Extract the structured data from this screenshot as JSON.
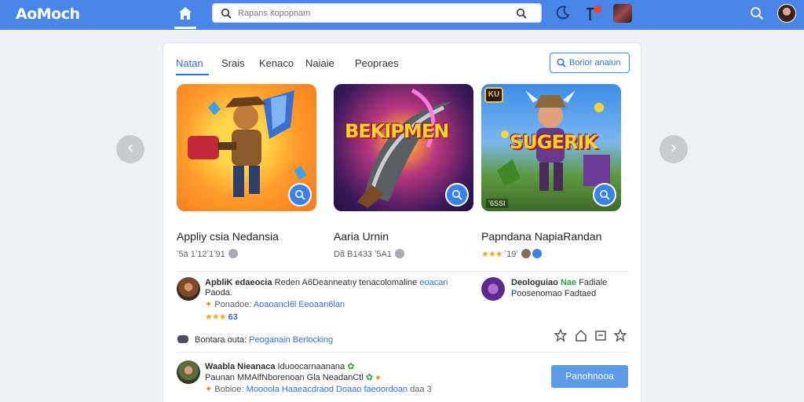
{
  "app": {
    "logo": "AoMoch"
  },
  "search": {
    "placeholder": "Rapans itopopnam",
    "value": ""
  },
  "tabs": [
    {
      "label": "Natan",
      "active": true
    },
    {
      "label": "Srais"
    },
    {
      "label": "Kenaco"
    },
    {
      "label": "Naiaie"
    },
    {
      "label": "Peopraes"
    }
  ],
  "card_action": {
    "label": "Borior anaiun"
  },
  "games": [
    {
      "title": "Appliy csia Nedansia",
      "meta": "ʼ5ä 1ʼ12ʼ1ʼ91"
    },
    {
      "art_text": "BEKIPMEN",
      "title": "Aaria Urnin",
      "meta": "Dã B1433 ʼ5A1"
    },
    {
      "art_text": "SUGERIK",
      "corner_badge": "KU",
      "bottom_tag": "ʼ6SSI",
      "title": "Papndana NapiaRandan",
      "stars": "★★★",
      "meta": "ʼ19ʼ"
    }
  ],
  "review1": {
    "name": "ApbliK edaeocia",
    "text": "Reden A6Deanneatıy tenacolomaline",
    "link": "eoacan",
    "line2": "Paoda.",
    "line3_prefix": "Ponadoe:",
    "line3_link": "Aoaoancl6l Eeoaan6lan",
    "stars": "★★★",
    "count": "63"
  },
  "review2": {
    "name": "Deologuiao",
    "name_tag": "Nae",
    "tag": "Fadiale",
    "line2": "Poosenomao Fadtaed"
  },
  "footer_row": {
    "label": "Bontara outa:",
    "link": "Peoganain Berlocking"
  },
  "review3": {
    "name": "Waabla Nieanaca",
    "text": "Iduoocarnaanana",
    "line2": "Paunan MMAlfNborenoan Gla NeadanCtl",
    "line3_prefix": "Bobioe:",
    "line3_link": "Moooola Haaeacdraod Doaao faeoordoan",
    "line3_suffix": "daa 3"
  },
  "primary_button": {
    "label": "Panohnooa"
  },
  "colors": {
    "topbar": "#4a86e8",
    "accent": "#2f6fd6",
    "button": "#5b9be8",
    "star": "#f2a71b"
  },
  "icons": [
    "home-icon",
    "search-icon",
    "moon-icon",
    "notification-icon",
    "star-icon",
    "bookmark-icon",
    "share-icon",
    "play-icon",
    "chevron-left-icon",
    "chevron-right-icon"
  ]
}
